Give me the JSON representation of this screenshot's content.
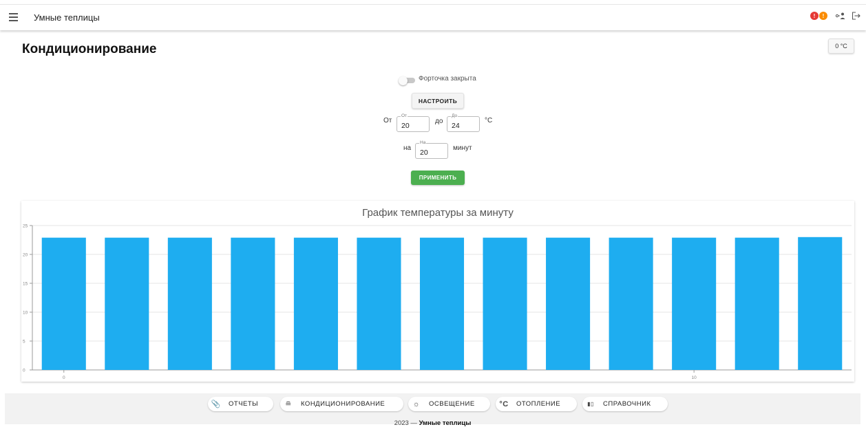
{
  "appbar": {
    "title": "Умные теплицы",
    "badges": [
      {
        "icon": "alert-icon",
        "color": "#e53935",
        "text": "!"
      },
      {
        "icon": "warning-icon",
        "color": "#fb8c00",
        "text": "!"
      }
    ]
  },
  "page": {
    "title": "Кондиционирование",
    "temp_button": "0 °C"
  },
  "controls": {
    "switch_label": "Форточка закрыта",
    "switch_on": false,
    "setup_button": "НАСТРОИТЬ",
    "from_label": "От",
    "from_legend": "От",
    "from_value": "20",
    "to_label": "до",
    "to_legend": "До",
    "to_value": "24",
    "unit": "°C",
    "for_label": "на",
    "for_legend": "На",
    "for_value": "20",
    "minutes_label": "минут",
    "apply_button": "ПРИМЕНИТЬ"
  },
  "chart_data": {
    "type": "bar",
    "title": "График температуры за минуту",
    "xlabel": "",
    "ylabel": "",
    "ylim": [
      0,
      25
    ],
    "yticks": [
      0,
      5,
      10,
      15,
      20,
      25
    ],
    "xticks": [
      0,
      10
    ],
    "x": [
      0,
      1,
      2,
      3,
      4,
      5,
      6,
      7,
      8,
      9,
      10,
      11,
      12
    ],
    "values": [
      22.9,
      22.9,
      22.9,
      22.9,
      22.9,
      22.9,
      22.9,
      22.9,
      22.9,
      22.9,
      22.9,
      22.9,
      23.0
    ],
    "bar_color": "#1eadf0",
    "grid": true,
    "legend": false
  },
  "footer": {
    "nav": [
      {
        "icon": "paperclip-icon",
        "glyph": "📎",
        "label": "ОТЧЕТЫ"
      },
      {
        "icon": "wind-icon",
        "glyph": "≘",
        "label": "КОНДИЦИОНИРОВАНИЕ"
      },
      {
        "icon": "sun-icon",
        "glyph": "☼",
        "label": "ОСВЕЩЕНИЕ"
      },
      {
        "icon": "celsius-icon",
        "glyph": "°C",
        "label": "ОТОПЛЕНИЕ"
      },
      {
        "icon": "book-icon",
        "glyph": "▮▯",
        "label": "СПРАВОЧНИК"
      }
    ],
    "year": "2023 —",
    "brand": "Умные теплицы"
  }
}
